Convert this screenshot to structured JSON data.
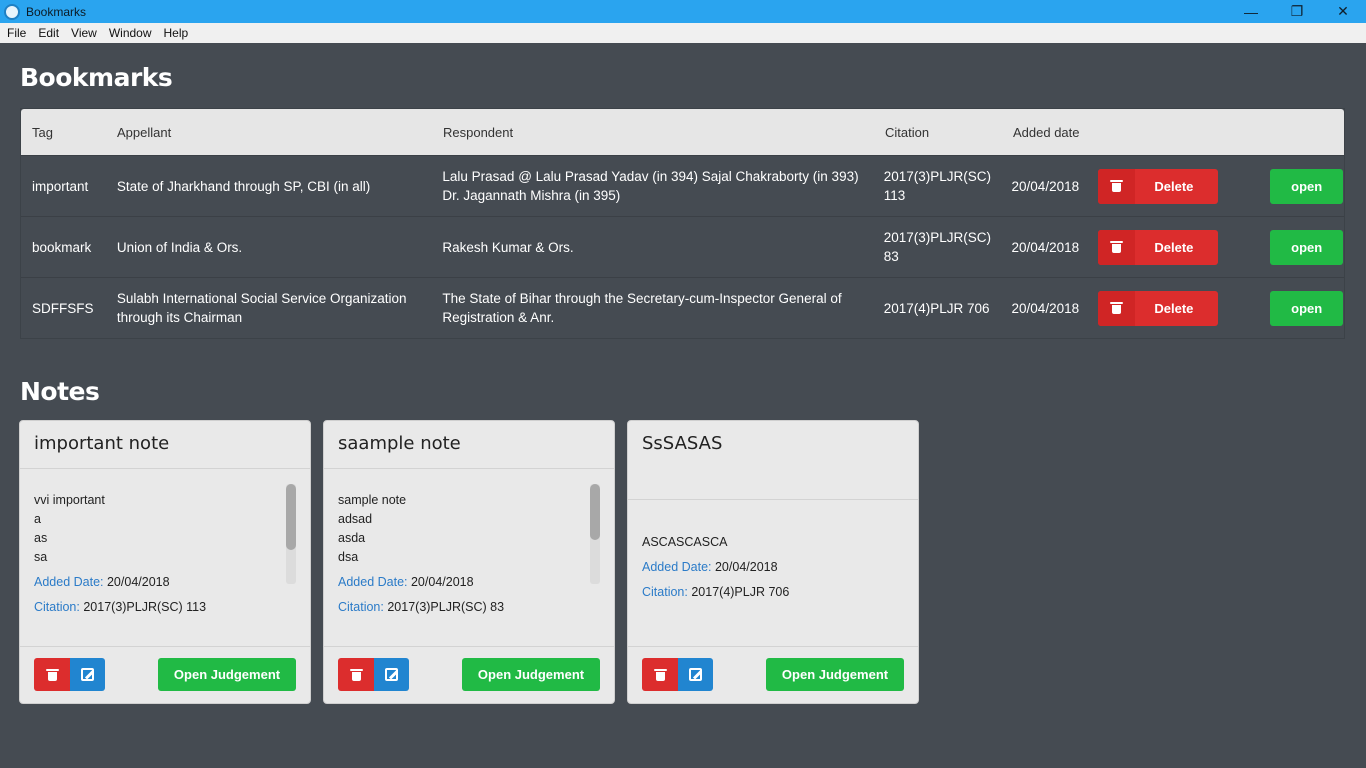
{
  "window": {
    "title": "Bookmarks",
    "minimize": "—",
    "restore": "❐",
    "close": "✕"
  },
  "menu": [
    "File",
    "Edit",
    "View",
    "Window",
    "Help"
  ],
  "page_title": "Bookmarks",
  "table": {
    "headers": {
      "tag": "Tag",
      "appellant": "Appellant",
      "respondent": "Respondent",
      "citation": "Citation",
      "added_date": "Added date"
    },
    "rows": [
      {
        "tag": "important",
        "appellant": "State of Jharkhand through SP, CBI (in all)",
        "respondent": "Lalu Prasad @ Lalu Prasad Yadav (in 394) Sajal Chakraborty (in 393) Dr. Jagannath Mishra (in 395)",
        "citation": "2017(3)PLJR(SC) 113",
        "date": "20/04/2018",
        "delete": "Delete",
        "open": "open"
      },
      {
        "tag": "bookmark",
        "appellant": "Union of India & Ors.",
        "respondent": "Rakesh Kumar & Ors.",
        "citation": "2017(3)PLJR(SC) 83",
        "date": "20/04/2018",
        "delete": "Delete",
        "open": "open"
      },
      {
        "tag": "SDFFSFS",
        "appellant": "Sulabh International Social Service Organization through its Chairman",
        "respondent": "The State of Bihar through the Secretary-cum-Inspector General of Registration & Anr.",
        "citation": "2017(4)PLJR 706",
        "date": "20/04/2018",
        "delete": "Delete",
        "open": "open"
      }
    ]
  },
  "notes_title": "Notes",
  "notes": [
    {
      "title": "important note",
      "lines": [
        "vvi important",
        "a",
        "as",
        "sa"
      ],
      "date_label": "Added Date:",
      "date": "20/04/2018",
      "citation_label": "Citation:",
      "citation": "2017(3)PLJR(SC) 113",
      "open_label": "Open Judgement"
    },
    {
      "title": "saample note",
      "lines": [
        "sample note",
        "adsad",
        "asda",
        "dsa"
      ],
      "date_label": "Added Date:",
      "date": "20/04/2018",
      "citation_label": "Citation:",
      "citation": "2017(3)PLJR(SC) 83",
      "open_label": "Open Judgement"
    },
    {
      "title": "SsSASAS",
      "lines": [
        "ASCASCASCA"
      ],
      "date_label": "Added Date:",
      "date": "20/04/2018",
      "citation_label": "Citation:",
      "citation": "2017(4)PLJR 706",
      "open_label": "Open Judgement"
    }
  ],
  "colors": {
    "titlebar": "#2aa4ef",
    "background": "#454b52",
    "delete": "#dc2d2d",
    "open": "#21ba45",
    "edit": "#2185d0",
    "label": "#2b7bc8"
  }
}
